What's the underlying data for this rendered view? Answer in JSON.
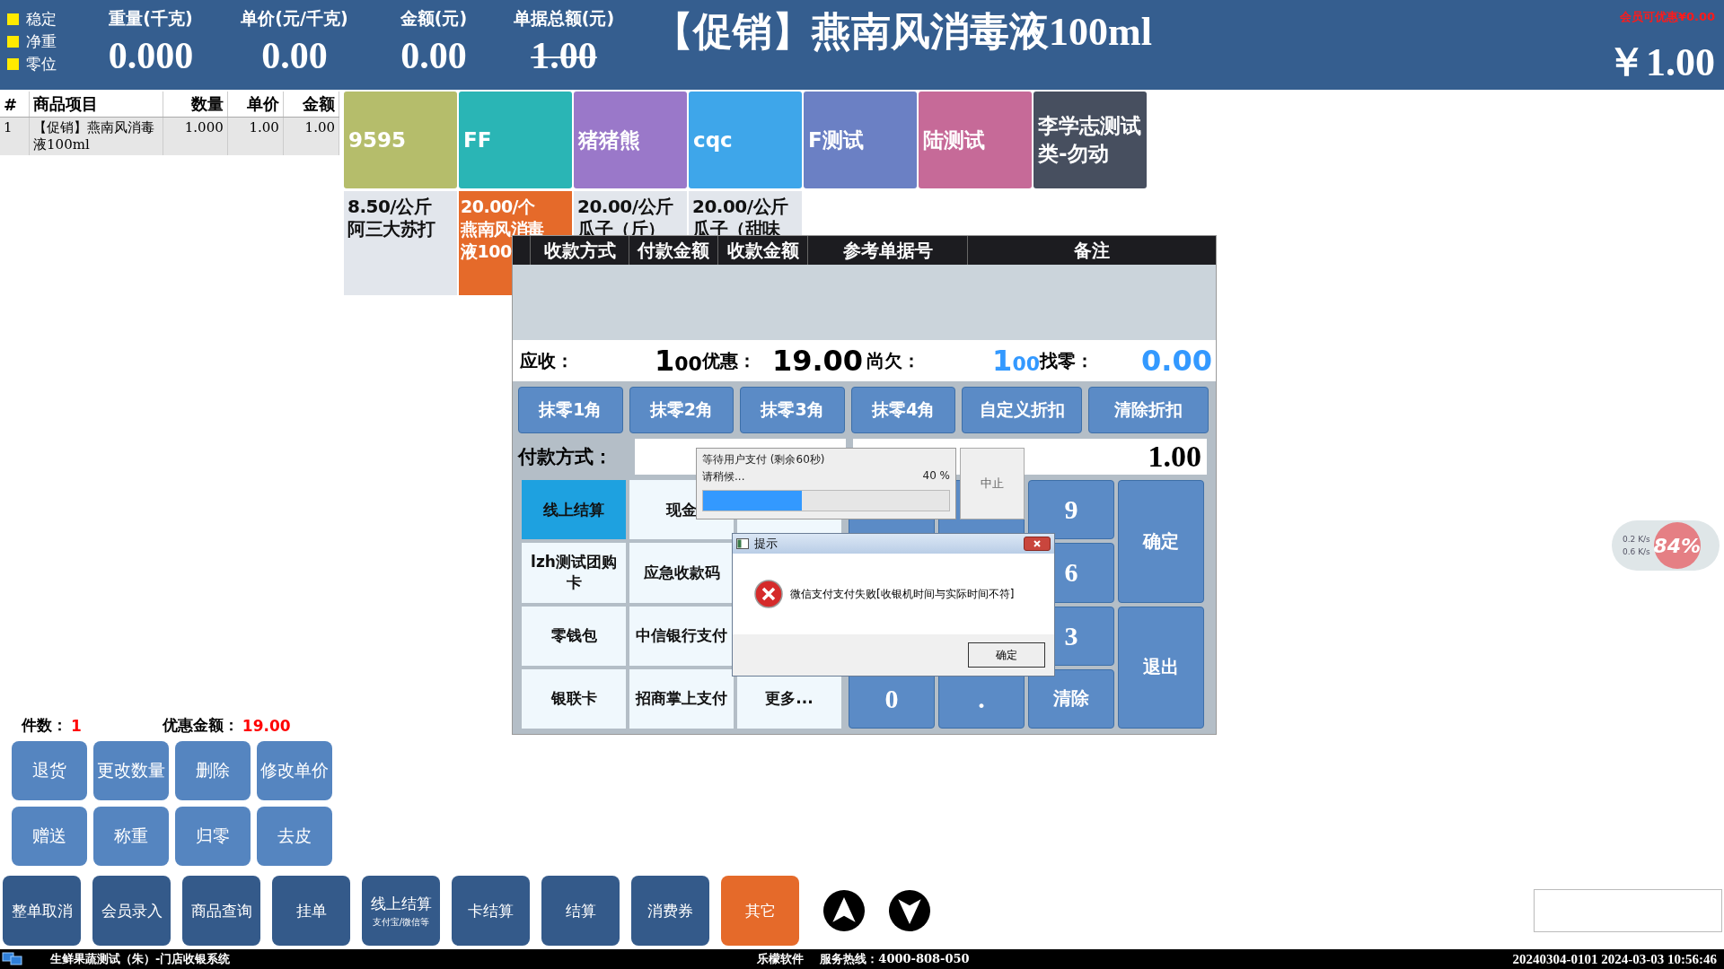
{
  "top_bar": {
    "indicators": [
      {
        "label": "稳定"
      },
      {
        "label": "净重"
      },
      {
        "label": "零位"
      }
    ],
    "fields": [
      {
        "label": "重量(千克)",
        "value": "0.000",
        "struck": false
      },
      {
        "label": "单价(元/千克)",
        "value": "0.00",
        "struck": false
      },
      {
        "label": "金额(元)",
        "value": "0.00",
        "struck": false
      },
      {
        "label": "单据总额(元)",
        "value": "1.00",
        "struck": true
      }
    ],
    "product_title": "【促销】燕南风消毒液100ml",
    "member_discount": "会员可优惠¥0.00",
    "total": "￥1.00"
  },
  "cart": {
    "columns": [
      "#",
      "商品项目",
      "数量",
      "单价",
      "金额"
    ],
    "rows": [
      [
        "1",
        "【促销】燕南风消毒液100ml",
        "1.000",
        "1.00",
        "1.00"
      ]
    ]
  },
  "categories": [
    {
      "label": "9595",
      "color": "#b5bd6b"
    },
    {
      "label": "FF",
      "color": "#2ab5b5"
    },
    {
      "label": "猪猪熊",
      "color": "#9a78c9"
    },
    {
      "label": "cqc",
      "color": "#3ea6ea"
    },
    {
      "label": "F测试",
      "color": "#6b80c4"
    },
    {
      "label": "陆测试",
      "color": "#c66a98"
    },
    {
      "label": "李学志测试类-勿动",
      "color": "#474f5f"
    }
  ],
  "products": [
    {
      "lines": [
        "8.50/公斤",
        "阿三大苏打"
      ],
      "selected": false
    },
    {
      "lines": [
        "20.00/个",
        "燕南风消毒",
        "液100"
      ],
      "selected": true
    },
    {
      "lines": [
        "20.00/公斤",
        "瓜子（斤）"
      ],
      "selected": false
    },
    {
      "lines": [
        "20.00/公斤",
        "瓜子（甜味"
      ],
      "selected": false
    }
  ],
  "summary": {
    "count_label": "件数：",
    "count": "1",
    "discount_label": "优惠金额：",
    "discount": "19.00"
  },
  "actions": [
    "退货",
    "更改数量",
    "删除",
    "修改单价",
    "赠送",
    "称重",
    "归零",
    "去皮"
  ],
  "bottom_buttons": [
    {
      "label": "整单取消",
      "highlighted": false
    },
    {
      "label": "会员录入",
      "highlighted": false
    },
    {
      "label": "商品查询",
      "highlighted": false
    },
    {
      "label": "挂单",
      "highlighted": false
    },
    {
      "label": "线上结算",
      "sub": "支付宝/微信等",
      "highlighted": false
    },
    {
      "label": "卡结算",
      "highlighted": false
    },
    {
      "label": "结算",
      "highlighted": false
    },
    {
      "label": "消费券",
      "highlighted": false
    },
    {
      "label": "其它",
      "highlighted": true
    }
  ],
  "payment_dialog": {
    "columns": [
      "收款方式",
      "付款金额",
      "收款金额",
      "参考单据号",
      "备注"
    ],
    "due_label": "应收：",
    "due": {
      "int": "1",
      "dec": "00"
    },
    "discount_label": "优惠：",
    "discount": "19.00",
    "owed_label": "尚欠：",
    "owed": {
      "int": "1",
      "dec": "00"
    },
    "change_label": "找零：",
    "change": "0.00",
    "quick_buttons": [
      "抹零1角",
      "抹零2角",
      "抹零3角",
      "抹零4角",
      "自定义折扣",
      "清除折扣"
    ],
    "method_label": "付款方式：",
    "amount": "1.00",
    "methods": [
      {
        "label": "线上结算",
        "selected": true
      },
      {
        "label": "现金",
        "selected": false
      },
      {
        "label": "lzh测试团购卡",
        "selected": false
      },
      {
        "label": "应急收款码",
        "selected": false
      },
      {
        "label": "零钱包",
        "selected": false
      },
      {
        "label": "中信银行支付",
        "selected": false
      },
      {
        "label": "银联卡",
        "selected": false
      },
      {
        "label": "招商掌上支付",
        "selected": false
      },
      {
        "label": "更多...",
        "selected": false
      }
    ],
    "keypad": [
      "9",
      "6",
      "3",
      "0",
      ".",
      "清除"
    ],
    "confirm": "确定",
    "exit": "退出"
  },
  "progress_popup": {
    "title": "等待用户支付 (剩余60秒)",
    "message": "请稍候...",
    "percent": "40 %",
    "level": 0.4,
    "cancel": "中止"
  },
  "alert": {
    "title": "提示",
    "message": "微信支付支付失败[收银机时间与实际时间不符]",
    "ok": "确定"
  },
  "network_widget": {
    "upload": "0.2 K/s",
    "download": "0.6 K/s",
    "usage": "84%"
  },
  "status_bar": {
    "app": "生鲜果蔬测试（朱）-门店收银系统",
    "vendor": "乐檬软件",
    "hotline": "服务热线：4000-808-050",
    "stamp": "20240304-0101 2024-03-03 10:56:46"
  }
}
